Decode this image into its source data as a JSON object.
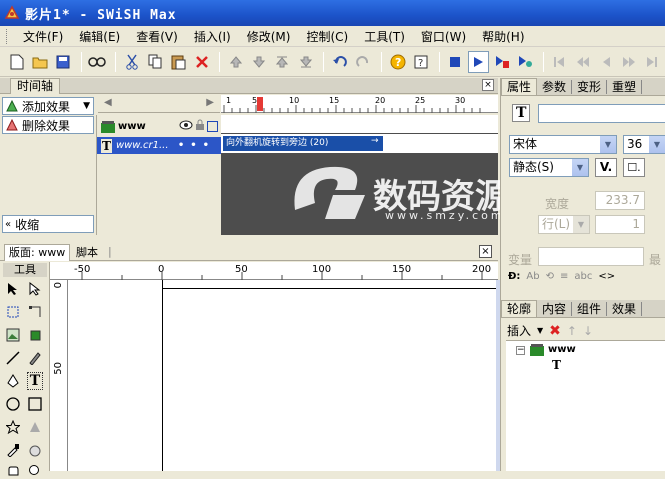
{
  "window": {
    "title": "影片1* - SWiSH Max"
  },
  "menu": [
    "文件(F)",
    "编辑(E)",
    "查看(V)",
    "插入(I)",
    "修改(M)",
    "控制(C)",
    "工具(T)",
    "窗口(W)",
    "帮助(H)"
  ],
  "timeline": {
    "tab_label": "时间轴",
    "add_effect": "添加效果",
    "remove_effect": "删除效果",
    "collapse": "收缩",
    "layer_scene": "www",
    "layer_text": "www.cr1...",
    "effect_bar_label": "向外翻机旋转到旁边 (20)",
    "ruler_ticks": [
      "1",
      "5",
      "10",
      "15",
      "20",
      "25",
      "30"
    ]
  },
  "properties_panel": {
    "tabs": [
      "属性",
      "参数",
      "变形",
      "重塑"
    ],
    "font_name": "宋体",
    "font_size": "36",
    "text_type": "静态(S)",
    "width_label": "宽度",
    "width_value": "233.7",
    "row_label": "行(L)",
    "row_value": "1",
    "variable_label": "变量",
    "max_label": "最"
  },
  "outline_panel": {
    "tabs": [
      "轮廓",
      "内容",
      "组件",
      "效果"
    ],
    "insert_label": "插入",
    "tree_root": "www",
    "tree_child": "T"
  },
  "stage": {
    "tab_label": "版面: www",
    "script_tab": "脚本",
    "tools_label": "工具",
    "hruler_ticks": [
      "-50",
      "0",
      "50",
      "100",
      "150",
      "200"
    ],
    "vruler_ticks": [
      "0",
      "50"
    ]
  },
  "watermark": {
    "main": "数码资源网",
    "sub": "www.smzy.com"
  },
  "colors": {
    "title_bar": "#1c53c9",
    "effect_bar": "#1a4fa8",
    "frames_bg": "#4d4d4d",
    "stage_gray": "#ece9d8"
  }
}
